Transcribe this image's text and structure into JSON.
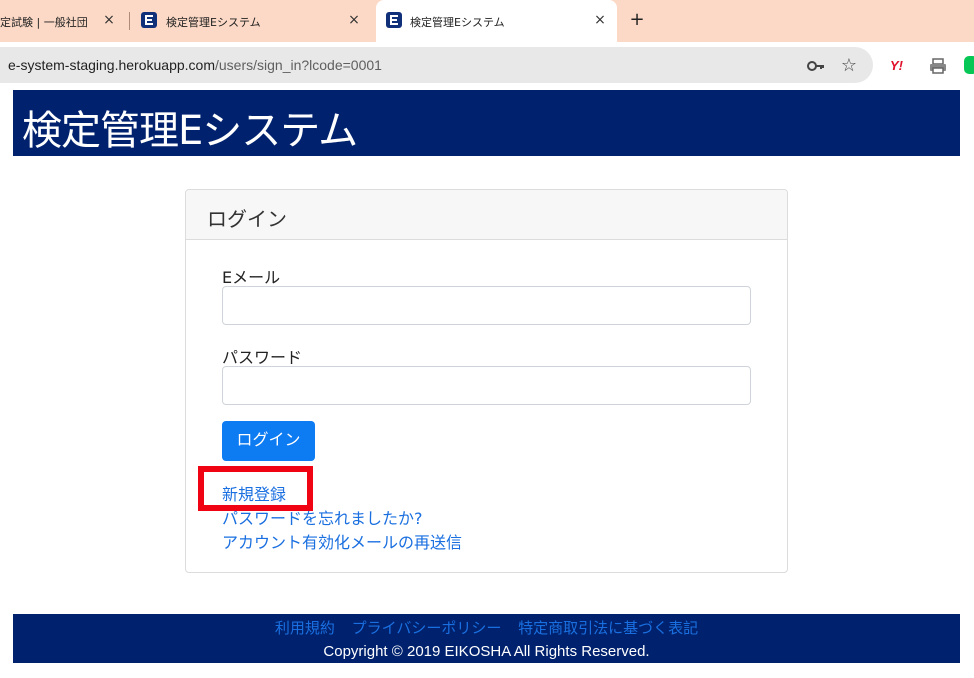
{
  "browser": {
    "tabs": [
      {
        "title": "定試験 | 一般社団",
        "close": "×"
      },
      {
        "title": "検定管理Eシステム",
        "close": "×"
      },
      {
        "title": "検定管理Eシステム",
        "close": "×",
        "active": true
      }
    ],
    "new_tab": "+",
    "url_host": "e-system-staging.herokuapp.com",
    "url_path": "/users/sign_in?lcode=0001",
    "extensions": {
      "yahoo": "Y!"
    }
  },
  "header": {
    "site_title": "検定管理Eシステム"
  },
  "login": {
    "card_title": "ログイン",
    "email_label": "Eメール",
    "email_value": "",
    "password_label": "パスワード",
    "password_value": "",
    "submit_label": "ログイン",
    "links": {
      "register": "新規登録",
      "forgot_password": "パスワードを忘れましたか?",
      "resend_confirmation": "アカウント有効化メールの再送信"
    }
  },
  "footer": {
    "links": [
      "利用規約",
      "プライバシーポリシー",
      "特定商取引法に基づく表記"
    ],
    "copyright": "Copyright © 2019 EIKOSHA All Rights Reserved."
  },
  "colors": {
    "header_bg": "#00226e",
    "primary": "#0d7bf2",
    "link": "#1a6fe0",
    "highlight": "#f00313",
    "tabstrip": "#fcd9c6"
  }
}
